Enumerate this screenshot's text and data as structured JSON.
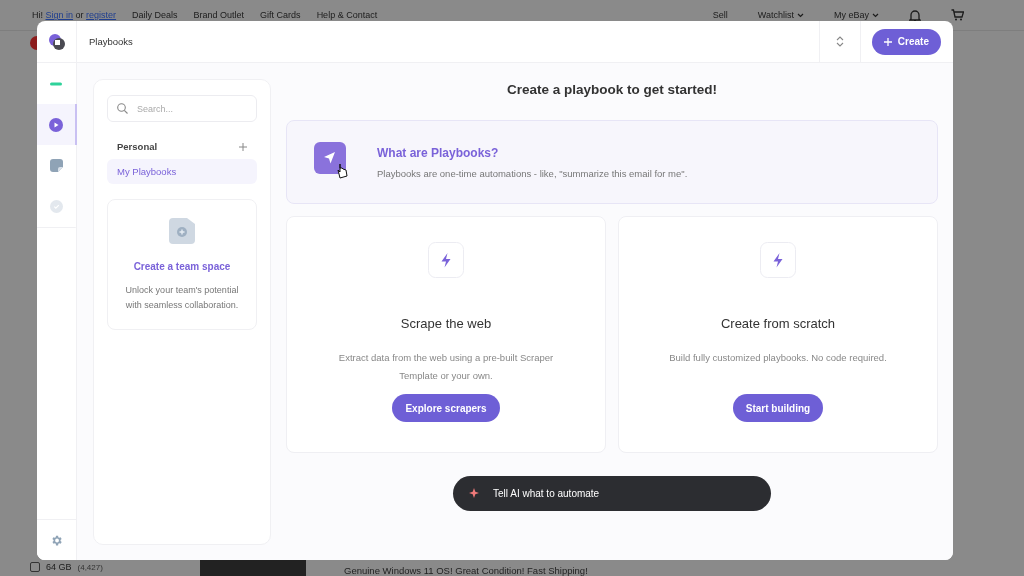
{
  "background_page": {
    "top_bar": {
      "greeting_prefix": "Hi!",
      "sign_in": "Sign in",
      "or": "or",
      "register": "register",
      "links": [
        "Daily Deals",
        "Brand Outlet",
        "Gift Cards",
        "Help & Contact"
      ],
      "right_links": [
        {
          "label": "Sell",
          "dropdown": false
        },
        {
          "label": "Watchlist",
          "dropdown": true
        },
        {
          "label": "My eBay",
          "dropdown": true
        }
      ]
    },
    "filter_option": {
      "label": "64 GB",
      "count": "(4,427)",
      "checked": false
    },
    "listing_title": "Genuine Windows 11 OS! Great Condition! Fast Shipping!"
  },
  "modal": {
    "title": "Playbooks",
    "create_button": "Create",
    "rail": [
      {
        "kind": "dash",
        "selected": false
      },
      {
        "kind": "play",
        "selected": true
      },
      {
        "kind": "note",
        "selected": false
      },
      {
        "kind": "check",
        "selected": false
      }
    ],
    "sidebar": {
      "search": {
        "placeholder": "Search..."
      },
      "section": "Personal",
      "items": [
        {
          "label": "My Playbooks",
          "selected": true
        }
      ],
      "team_card": {
        "title": "Create a team space",
        "text": "Unlock your team's potential with seamless collaboration."
      }
    },
    "main": {
      "heading": "Create a playbook to get started!",
      "info": {
        "title": "What are Playbooks?",
        "text": "Playbooks are one-time automations - like, \"summarize this email for me\"."
      },
      "cards": [
        {
          "title": "Scrape the web",
          "text": "Extract data from the web using a pre-built Scraper Template or your own.",
          "button": "Explore scrapers"
        },
        {
          "title": "Create from scratch",
          "text": "Build fully customized playbooks. No code required.",
          "button": "Start building"
        }
      ],
      "ai_bar": "Tell AI what to automate"
    }
  }
}
